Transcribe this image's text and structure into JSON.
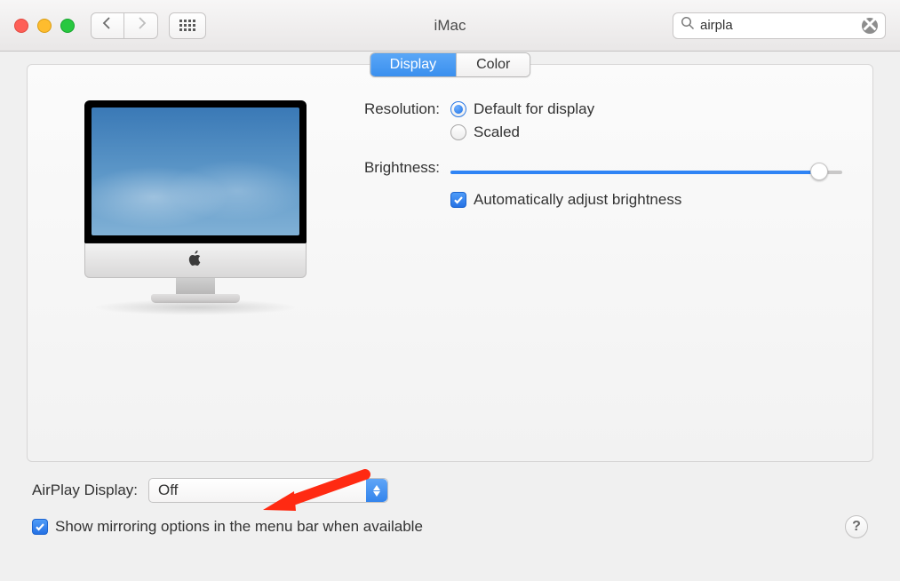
{
  "window": {
    "title": "iMac"
  },
  "search": {
    "query": "airpla"
  },
  "tabs": {
    "active": "Display",
    "inactive": "Color"
  },
  "resolution": {
    "label": "Resolution:",
    "opt_default": "Default for display",
    "opt_scaled": "Scaled"
  },
  "brightness": {
    "label": "Brightness:",
    "auto_label": "Automatically adjust brightness"
  },
  "airplay": {
    "label": "AirPlay Display:",
    "value": "Off"
  },
  "mirroring": {
    "label": "Show mirroring options in the menu bar when available"
  },
  "help": {
    "label": "?"
  }
}
